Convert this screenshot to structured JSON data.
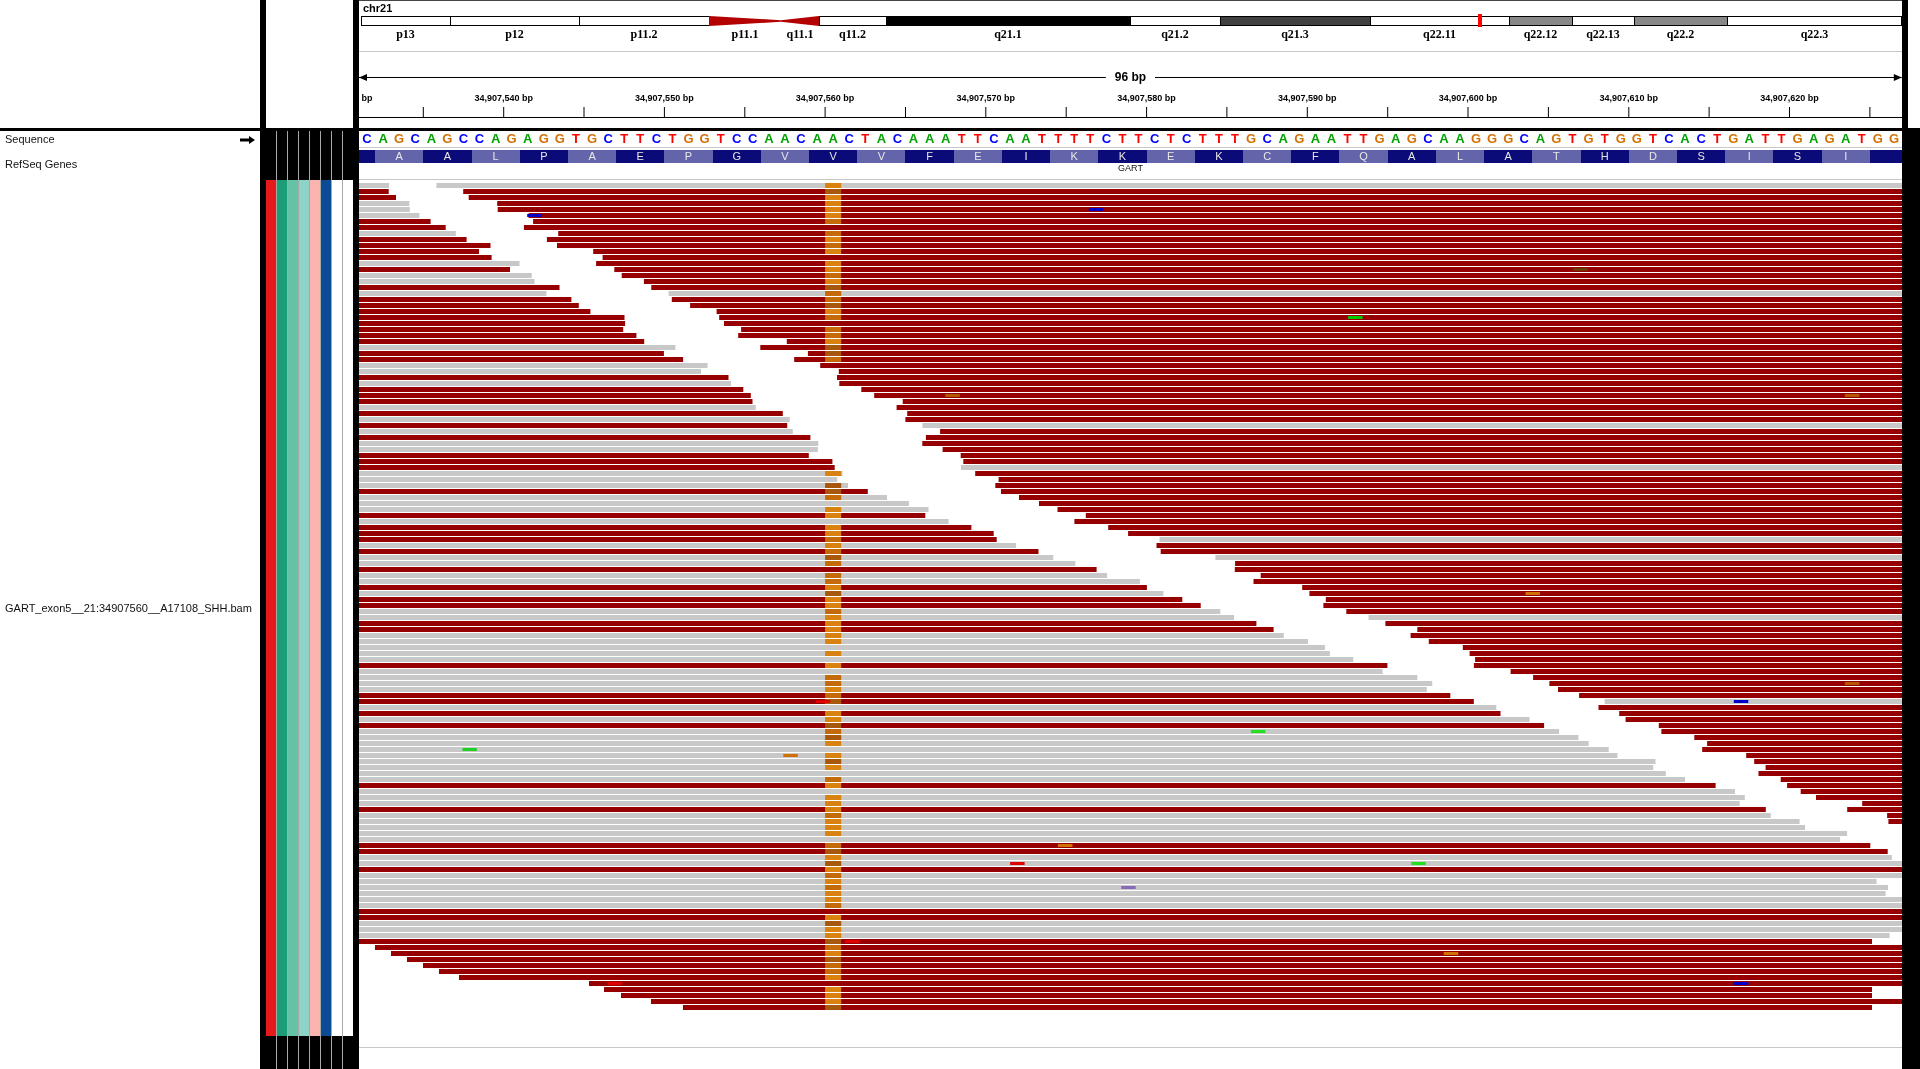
{
  "ideogram": {
    "chromosome": "chr21",
    "bands": [
      {
        "name": "p13",
        "kind": "gneg",
        "in_view": false
      },
      {
        "name": "p12",
        "kind": "gneg",
        "in_view": false
      },
      {
        "name": "p11.2",
        "kind": "gneg",
        "in_view": false
      },
      {
        "name": "p11.1",
        "kind": "acen",
        "in_view": false
      },
      {
        "name": "q11.1",
        "kind": "acen",
        "in_view": false
      },
      {
        "name": "q11.2",
        "kind": "gneg",
        "in_view": false
      },
      {
        "name": "q21.1",
        "kind": "gpos100",
        "in_view": false
      },
      {
        "name": "q21.2",
        "kind": "gneg",
        "in_view": false
      },
      {
        "name": "q21.3",
        "kind": "gpos75",
        "in_view": false
      },
      {
        "name": "q22.11",
        "kind": "gneg",
        "in_view": true
      },
      {
        "name": "q22.12",
        "kind": "gpos50",
        "in_view": false
      },
      {
        "name": "q22.13",
        "kind": "gneg",
        "in_view": false
      },
      {
        "name": "q22.2",
        "kind": "gpos50",
        "in_view": false
      },
      {
        "name": "q22.3",
        "kind": "gneg",
        "in_view": false
      }
    ]
  },
  "ruler": {
    "span": "96 bp",
    "unit_label": "bp",
    "ticks": [
      "34,907,540 bp",
      "34,907,550 bp",
      "34,907,560 bp",
      "34,907,570 bp",
      "34,907,580 bp",
      "34,907,590 bp",
      "34,907,600 bp",
      "34,907,610 bp",
      "34,907,620 bp"
    ]
  },
  "tracks": [
    {
      "kind": "sequence",
      "name": "Sequence",
      "reverse_strand": false,
      "bases": [
        {
          "base": "C",
          "color": "#0000ff"
        },
        {
          "base": "A",
          "color": "#00a000"
        },
        {
          "base": "G",
          "color": "#d17105"
        },
        {
          "base": "C",
          "color": "#0000ff"
        },
        {
          "base": "A",
          "color": "#00a000"
        },
        {
          "base": "G",
          "color": "#d17105"
        },
        {
          "base": "C",
          "color": "#0000ff"
        },
        {
          "base": "C",
          "color": "#0000ff"
        },
        {
          "base": "A",
          "color": "#00a000"
        },
        {
          "base": "G",
          "color": "#d17105"
        },
        {
          "base": "A",
          "color": "#00a000"
        },
        {
          "base": "G",
          "color": "#d17105"
        },
        {
          "base": "G",
          "color": "#d17105"
        },
        {
          "base": "T",
          "color": "#ff0000"
        },
        {
          "base": "G",
          "color": "#d17105"
        },
        {
          "base": "C",
          "color": "#0000ff"
        },
        {
          "base": "T",
          "color": "#ff0000"
        },
        {
          "base": "T",
          "color": "#ff0000"
        },
        {
          "base": "C",
          "color": "#0000ff"
        },
        {
          "base": "T",
          "color": "#ff0000"
        },
        {
          "base": "G",
          "color": "#d17105"
        },
        {
          "base": "G",
          "color": "#d17105"
        },
        {
          "base": "T",
          "color": "#ff0000"
        },
        {
          "base": "C",
          "color": "#0000ff"
        },
        {
          "base": "C",
          "color": "#0000ff"
        },
        {
          "base": "A",
          "color": "#00a000"
        },
        {
          "base": "A",
          "color": "#00a000"
        },
        {
          "base": "C",
          "color": "#0000ff"
        },
        {
          "base": "A",
          "color": "#00a000"
        },
        {
          "base": "A",
          "color": "#00a000"
        },
        {
          "base": "C",
          "color": "#0000ff"
        },
        {
          "base": "T",
          "color": "#ff0000"
        },
        {
          "base": "A",
          "color": "#00a000"
        },
        {
          "base": "C",
          "color": "#0000ff"
        },
        {
          "base": "A",
          "color": "#00a000"
        },
        {
          "base": "A",
          "color": "#00a000"
        },
        {
          "base": "A",
          "color": "#00a000"
        },
        {
          "base": "T",
          "color": "#ff0000"
        },
        {
          "base": "T",
          "color": "#ff0000"
        },
        {
          "base": "C",
          "color": "#0000ff"
        },
        {
          "base": "A",
          "color": "#00a000"
        },
        {
          "base": "A",
          "color": "#00a000"
        },
        {
          "base": "T",
          "color": "#ff0000"
        },
        {
          "base": "T",
          "color": "#ff0000"
        },
        {
          "base": "T",
          "color": "#ff0000"
        },
        {
          "base": "T",
          "color": "#ff0000"
        },
        {
          "base": "C",
          "color": "#0000ff"
        },
        {
          "base": "T",
          "color": "#ff0000"
        },
        {
          "base": "T",
          "color": "#ff0000"
        },
        {
          "base": "C",
          "color": "#0000ff"
        },
        {
          "base": "T",
          "color": "#ff0000"
        },
        {
          "base": "C",
          "color": "#0000ff"
        },
        {
          "base": "T",
          "color": "#ff0000"
        },
        {
          "base": "T",
          "color": "#ff0000"
        },
        {
          "base": "T",
          "color": "#ff0000"
        },
        {
          "base": "G",
          "color": "#d17105"
        },
        {
          "base": "C",
          "color": "#0000ff"
        },
        {
          "base": "A",
          "color": "#00a000"
        },
        {
          "base": "G",
          "color": "#d17105"
        },
        {
          "base": "A",
          "color": "#00a000"
        },
        {
          "base": "A",
          "color": "#00a000"
        },
        {
          "base": "T",
          "color": "#ff0000"
        },
        {
          "base": "T",
          "color": "#ff0000"
        },
        {
          "base": "G",
          "color": "#d17105"
        },
        {
          "base": "A",
          "color": "#00a000"
        },
        {
          "base": "G",
          "color": "#d17105"
        },
        {
          "base": "C",
          "color": "#0000ff"
        },
        {
          "base": "A",
          "color": "#00a000"
        },
        {
          "base": "A",
          "color": "#00a000"
        },
        {
          "base": "G",
          "color": "#d17105"
        },
        {
          "base": "G",
          "color": "#d17105"
        },
        {
          "base": "G",
          "color": "#d17105"
        },
        {
          "base": "C",
          "color": "#0000ff"
        },
        {
          "base": "A",
          "color": "#00a000"
        },
        {
          "base": "G",
          "color": "#d17105"
        },
        {
          "base": "T",
          "color": "#ff0000"
        },
        {
          "base": "G",
          "color": "#d17105"
        },
        {
          "base": "T",
          "color": "#ff0000"
        },
        {
          "base": "G",
          "color": "#d17105"
        },
        {
          "base": "G",
          "color": "#d17105"
        },
        {
          "base": "T",
          "color": "#ff0000"
        },
        {
          "base": "C",
          "color": "#0000ff"
        },
        {
          "base": "A",
          "color": "#00a000"
        },
        {
          "base": "C",
          "color": "#0000ff"
        },
        {
          "base": "T",
          "color": "#ff0000"
        },
        {
          "base": "G",
          "color": "#d17105"
        },
        {
          "base": "A",
          "color": "#00a000"
        },
        {
          "base": "T",
          "color": "#ff0000"
        },
        {
          "base": "T",
          "color": "#ff0000"
        },
        {
          "base": "G",
          "color": "#d17105"
        },
        {
          "base": "A",
          "color": "#00a000"
        },
        {
          "base": "G",
          "color": "#d17105"
        },
        {
          "base": "A",
          "color": "#00a000"
        },
        {
          "base": "T",
          "color": "#ff0000"
        },
        {
          "base": "G",
          "color": "#d17105"
        },
        {
          "base": "G",
          "color": "#d17105"
        }
      ]
    },
    {
      "kind": "gene",
      "name": "RefSeq Genes",
      "gene": "GART",
      "amino_acids": [
        "A",
        "A",
        "L",
        "P",
        "A",
        "E",
        "P",
        "G",
        "V",
        "V",
        "V",
        "F",
        "E",
        "I",
        "K",
        "K",
        "E",
        "K",
        "C",
        "F",
        "Q",
        "A",
        "L",
        "A",
        "T",
        "H",
        "D",
        "S",
        "I",
        "S",
        "I"
      ]
    },
    {
      "kind": "alignment",
      "name": "GART_exon5__21:34907560__A17108_SHH.bam",
      "attributes": [
        {
          "color": "#e41a1c"
        },
        {
          "color": "#1b9e77"
        },
        {
          "color": "#66c2a5"
        },
        {
          "color": "#8dd3c7"
        },
        {
          "color": "#fbb4ae"
        },
        {
          "color": "#0b4a94"
        },
        {
          "color": "#ffffff"
        },
        {
          "color": "#ffffff"
        }
      ]
    }
  ]
}
